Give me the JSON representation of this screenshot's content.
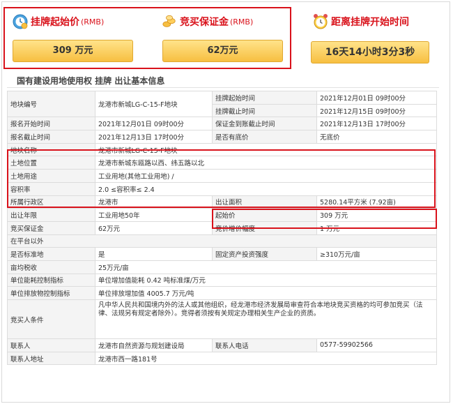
{
  "banner": {
    "start_price": {
      "icon": "coin-clock-icon",
      "label": "挂牌起始价",
      "unit": "(RMB)",
      "value": "309  万元"
    },
    "deposit": {
      "icon": "coins-icon",
      "label": "竞买保证金",
      "unit": "(RMB)",
      "value": "62万元"
    },
    "countdown": {
      "icon": "alarm-clock-icon",
      "label": "距离挂牌开始时间",
      "value": "16天14小时3分3秒"
    },
    "colors": {
      "accent_red": "#d9121b",
      "gold": "#f7bf41"
    }
  },
  "section_title": "国有建设用地使用权 挂牌 出让基本信息",
  "table": {
    "r1": {
      "l1": "地块编号",
      "v1": "龙港市新城LG-C-15-F地块",
      "l2a": "挂牌起始时间",
      "v2a": "2021年12月01日 09时00分",
      "l2b": "挂牌截止时间",
      "v2b": "2021年12月15日 09时00分"
    },
    "r2": {
      "l1": "报名开始时间",
      "v1": "2021年12月01日 09时00分",
      "l2": "保证金到账截止时间",
      "v2": "2021年12月13日 17时00分"
    },
    "r3": {
      "l1": "报名截止时间",
      "v1": "2021年12月13日 17时00分",
      "l2": "是否有底价",
      "v2": "无底价"
    },
    "r4": {
      "l1": "地块名称",
      "v1": "龙港市新城LG-C-15-F地块"
    },
    "r5": {
      "l1": "土地位置",
      "v1": "龙港市新城东瓯路以西、纬五路以北"
    },
    "r6": {
      "l1": "土地用途",
      "v1": "工业用地(其他工业用地) /"
    },
    "r7": {
      "l1": "容积率",
      "v1": "2.0 ≤容积率≤ 2.4"
    },
    "r8": {
      "l1": "所属行政区",
      "v1": "龙港市",
      "l2": "出让面积",
      "v2": "5280.14平方米 (7.92亩)"
    },
    "r9": {
      "l1": "出让年限",
      "v1": "工业用地50年",
      "l2": "起始价",
      "v2": "309 万元"
    },
    "r10": {
      "l1": "竞买保证金",
      "v1": "62万元",
      "l2": "竞价增价幅度",
      "v2": "1 万元"
    },
    "r11": {
      "l1": "在平台以外"
    },
    "r12": {
      "l1": "是否标准地",
      "v1": "是",
      "l2": "固定资产投资强度",
      "v2": "≥310万元/亩"
    },
    "r13": {
      "l1": "亩均税收",
      "v1": "25万元/亩"
    },
    "r14": {
      "l1": "单位能耗控制指标",
      "v1": "单位增加值能耗 0.42 吨标准煤/万元"
    },
    "r15": {
      "l1": "单位排放物控制指标",
      "v1": "单位排放增加值 4005.7 万元/吨"
    },
    "r16": {
      "l1": "竞买人条件",
      "v1": "凡中华人民共和国境内外的法人或其他组织，经龙港市经济发展局审查符合本地块竞买资格的均可参加竞买（法律、法规另有规定者除外）。竞得者须按有关规定办理相关生产企业的资质。"
    },
    "r17": {
      "l1": "联系人",
      "v1": "龙港市自然资源与规划建设局",
      "l2": "联系人电话",
      "v2": "0577-59902566"
    },
    "r18": {
      "l1": "联系人地址",
      "v1": "龙港市西一路181号"
    }
  }
}
